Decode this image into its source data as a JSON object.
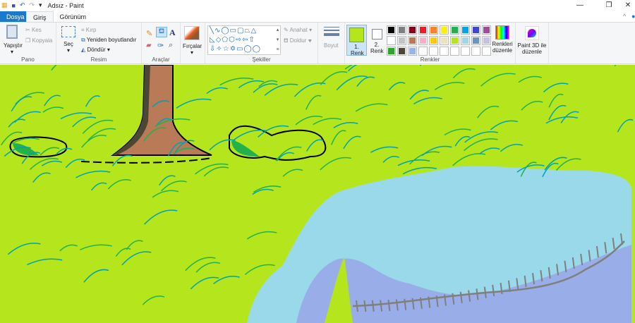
{
  "window": {
    "title": "Adsız - Paint"
  },
  "tabs": [
    {
      "label": "Dosya"
    },
    {
      "label": "Giriş"
    },
    {
      "label": "Görünüm"
    }
  ],
  "ribbon": {
    "clipboard": {
      "group": "Pano",
      "paste": "Yapıştır",
      "cut": "Kes",
      "copy": "Kopyala"
    },
    "image": {
      "group": "Resim",
      "select": "Seç",
      "crop": "Kırp",
      "resize": "Yeniden boyutlandır",
      "rotate": "Döndür"
    },
    "tools": {
      "group": "Araçlar"
    },
    "brushes": {
      "label": "Fırçalar"
    },
    "shapes": {
      "group": "Şekiller",
      "outline": "Anahat",
      "fill": "Doldur"
    },
    "size": {
      "label": "Boyut"
    },
    "colors": {
      "group": "Renkler",
      "color1": "1. Renk",
      "color2": "2. Renk",
      "edit": "Renkleri düzenle",
      "color1_value": "#b5e61d",
      "color2_value": "#ffffff",
      "palette": [
        "#000000",
        "#7f7f7f",
        "#880015",
        "#ed1c24",
        "#ff7f27",
        "#fff200",
        "#22b14c",
        "#00a2e8",
        "#3f48cc",
        "#a349a4",
        "#ffffff",
        "#c3c3c3",
        "#b97a57",
        "#ffaec9",
        "#ffc90e",
        "#efe4b0",
        "#b5e61d",
        "#99d9ea",
        "#7092be",
        "#c8bfe7",
        "#2aa72a",
        "#4e4634",
        "#99b4e8",
        "",
        "",
        "",
        "",
        "",
        "",
        ""
      ]
    },
    "paint3d": {
      "label": "Paint 3D ile düzenle"
    }
  },
  "canvas": {
    "background": "#b5e61d",
    "water": "#99d9ea",
    "shallow": "#99a8e8"
  }
}
